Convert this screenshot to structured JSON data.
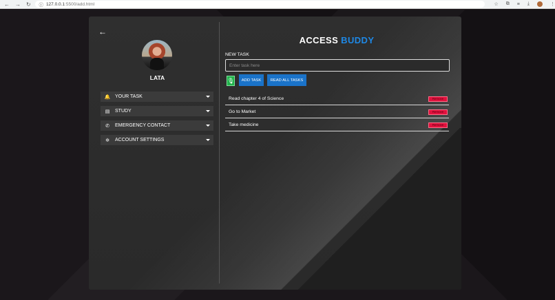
{
  "browser": {
    "url_host": "127.0.0.1",
    "url_rest": ":5500/add.html"
  },
  "profile": {
    "name": "LATA"
  },
  "menu": {
    "items": [
      {
        "label": "YOUR TASK",
        "icon": "bell-icon",
        "glyph": "🔔"
      },
      {
        "label": "STUDY",
        "icon": "book-icon",
        "glyph": "▤"
      },
      {
        "label": "EMERGENCY CONTACT",
        "icon": "phone-icon",
        "glyph": "✆"
      },
      {
        "label": "ACCOUNT SETTINGS",
        "icon": "gear-icon",
        "glyph": "✲"
      }
    ]
  },
  "header": {
    "title_part1": "ACCESS",
    "title_part2": "BUDDY"
  },
  "form": {
    "new_task_label": "NEW TASK",
    "placeholder": "Enter task here",
    "value": "",
    "add_label": "ADD TASK",
    "read_label": "READ ALL TASKS"
  },
  "tasks": [
    {
      "text": "Read chapter 4 of Science",
      "remove_label": "Remove"
    },
    {
      "text": "Go to Market",
      "remove_label": "Remove"
    },
    {
      "text": "Take medicine",
      "remove_label": "Remove"
    }
  ],
  "colors": {
    "accent": "#1e88e5",
    "mic": "#21b24b",
    "remove": "#e0113d",
    "button": "#1a73c9"
  }
}
